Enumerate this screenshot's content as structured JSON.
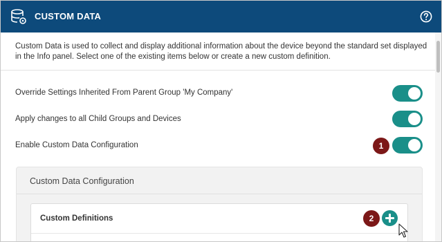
{
  "header": {
    "title": "CUSTOM DATA",
    "icon": "database-icon",
    "help_icon": "help-circle-icon"
  },
  "description": "Custom Data is used to collect and display additional information about the device beyond the standard set displayed in the Info panel. Select one of the existing items below or create a new custom definition.",
  "settings": [
    {
      "label": "Override Settings Inherited From Parent Group 'My Company'",
      "enabled": true
    },
    {
      "label": "Apply changes to all Child Groups and Devices",
      "enabled": true
    },
    {
      "label": "Enable Custom Data Configuration",
      "enabled": true
    }
  ],
  "badges": {
    "first": "1",
    "second": "2"
  },
  "config_panel": {
    "title": "Custom Data Configuration",
    "definitions_title": "Custom Definitions",
    "add_icon": "plus-icon"
  },
  "colors": {
    "header_bg": "#0d4a7b",
    "toggle_on": "#1a8f89",
    "badge": "#7c1818"
  }
}
